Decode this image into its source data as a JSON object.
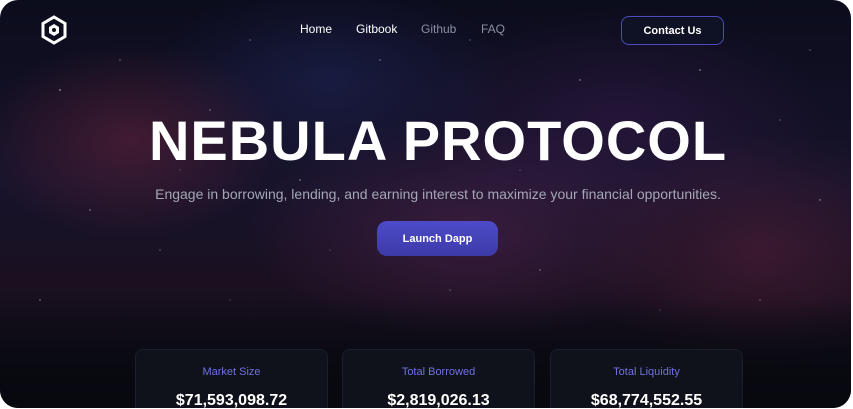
{
  "brand": {
    "logo_icon": "nebula-hexagon-logo-icon"
  },
  "nav": {
    "items": [
      {
        "label": "Home"
      },
      {
        "label": "Gitbook"
      },
      {
        "label": "Github"
      },
      {
        "label": "FAQ"
      }
    ],
    "contact_label": "Contact Us"
  },
  "hero": {
    "title": "NEBULA PROTOCOL",
    "subtitle": "Engage in borrowing, lending, and earning interest to maximize your financial opportunities.",
    "cta_label": "Launch Dapp"
  },
  "stats": [
    {
      "label": "Market Size",
      "value": "$71,593,098.72"
    },
    {
      "label": "Total Borrowed",
      "value": "$2,819,026.13"
    },
    {
      "label": "Total Liquidity",
      "value": "$68,774,552.55"
    }
  ],
  "colors": {
    "accent": "#4b4cbf",
    "stat_label": "#6e72e0",
    "nav_active": "#ffffff",
    "nav_inactive": "#8a8fa3"
  }
}
